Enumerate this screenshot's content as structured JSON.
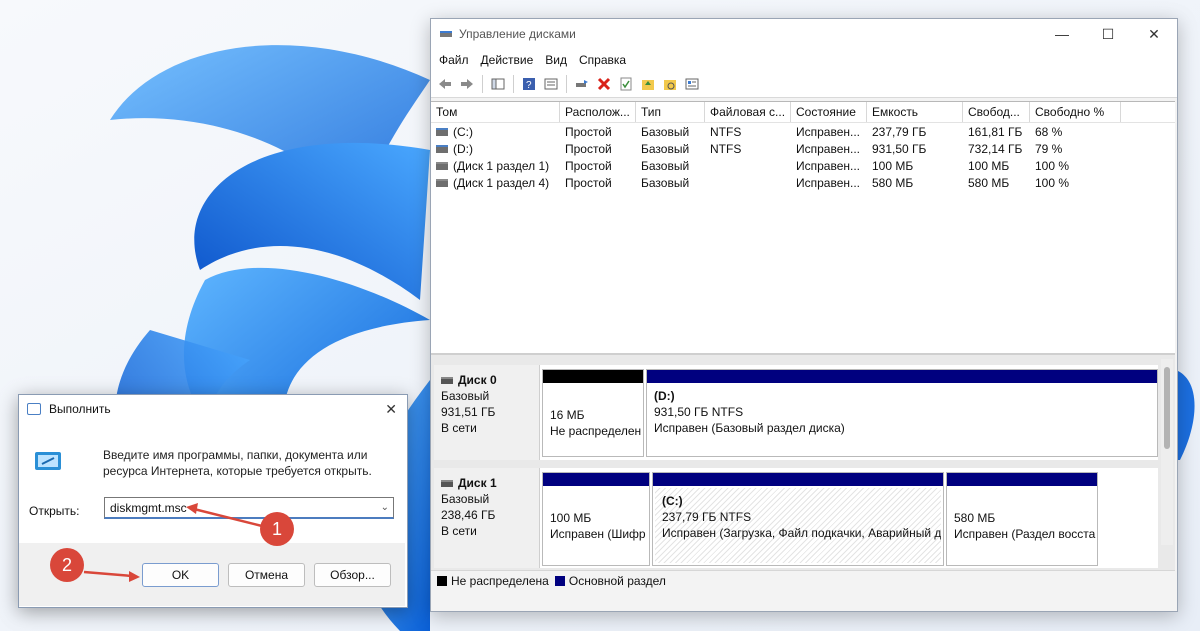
{
  "disk_mgmt": {
    "title": "Управление дисками",
    "menu": [
      "Файл",
      "Действие",
      "Вид",
      "Справка"
    ],
    "toolbar_icons": [
      "back-arrow-icon",
      "forward-arrow-icon",
      "console-tree-icon",
      "help-icon",
      "properties-list-icon",
      "connect-icon",
      "delete-x-icon",
      "check-icon",
      "folder-up-icon",
      "folder-find-icon",
      "details-icon"
    ],
    "columns": [
      "Том",
      "Располож...",
      "Тип",
      "Файловая с...",
      "Состояние",
      "Емкость",
      "Свобод...",
      "Свободно %"
    ],
    "volumes": [
      [
        "(C:)",
        "Простой",
        "Базовый",
        "NTFS",
        "Исправен...",
        "237,79 ГБ",
        "161,81 ГБ",
        "68 %"
      ],
      [
        "(D:)",
        "Простой",
        "Базовый",
        "NTFS",
        "Исправен...",
        "931,50 ГБ",
        "732,14 ГБ",
        "79 %"
      ],
      [
        "(Диск 1 раздел 1)",
        "Простой",
        "Базовый",
        "",
        "Исправен...",
        "100 МБ",
        "100 МБ",
        "100 %"
      ],
      [
        "(Диск 1 раздел 4)",
        "Простой",
        "Базовый",
        "",
        "Исправен...",
        "580 МБ",
        "580 МБ",
        "100 %"
      ]
    ],
    "disk0": {
      "name": "Диск 0",
      "type": "Базовый",
      "size": "931,51 ГБ",
      "status": "В сети",
      "p1": {
        "line1": "16 МБ",
        "line2": "Не распределен"
      },
      "p2": {
        "name": "(D:)",
        "line1": "931,50 ГБ NTFS",
        "line2": "Исправен (Базовый раздел диска)"
      }
    },
    "disk1": {
      "name": "Диск 1",
      "type": "Базовый",
      "size": "238,46 ГБ",
      "status": "В сети",
      "p1": {
        "line1": "100 МБ",
        "line2": "Исправен (Шифр"
      },
      "p2": {
        "name": "(C:)",
        "line1": "237,79 ГБ NTFS",
        "line2": "Исправен (Загрузка, Файл подкачки, Аварийный д"
      },
      "p3": {
        "line1": "580 МБ",
        "line2": "Исправен (Раздел восста"
      }
    },
    "legend": {
      "unallocated": "Не распределена",
      "primary": "Основной раздел"
    },
    "colors": {
      "unallocated": "#000000",
      "primary": "#00007f"
    }
  },
  "run": {
    "title": "Выполнить",
    "description": "Введите имя программы, папки, документа или ресурса Интернета, которые требуется открыть.",
    "open_label": "Открыть:",
    "input_value": "diskmgmt.msc",
    "ok": "OK",
    "cancel": "Отмена",
    "browse": "Обзор..."
  },
  "annotations": {
    "badge1": "1",
    "badge2": "2",
    "accent": "#d9473a"
  }
}
